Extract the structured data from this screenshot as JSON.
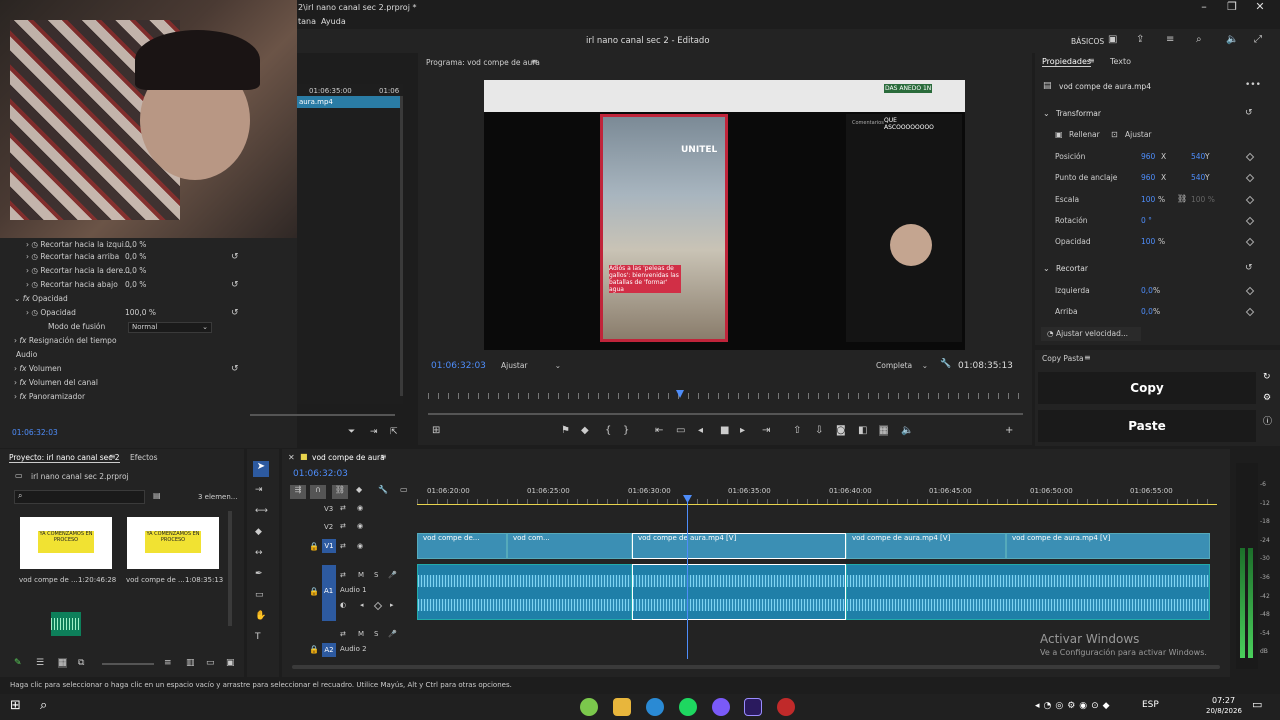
{
  "window": {
    "title": "2\\irl nano canal sec 2.prproj *",
    "menu": [
      "tana",
      "Ayuda"
    ],
    "project_title": "irl nano canal sec 2 - Editado",
    "workspace": "BÁSICOS"
  },
  "source": {
    "time_marker": "01:06:35:00",
    "time_marker2": "01:06",
    "clip_label": "aura.mp4",
    "timecode": "01:06:32:03"
  },
  "effects": {
    "rows": [
      {
        "label": "Recortar hacia la izqui...",
        "value": "0,0 %"
      },
      {
        "label": "Recortar hacia arriba",
        "value": "0,0 %"
      },
      {
        "label": "Recortar hacia la dere...",
        "value": "0,0 %"
      },
      {
        "label": "Recortar hacia abajo",
        "value": "0,0 %"
      }
    ],
    "opacity_group": "Opacidad",
    "opacity_label": "Opacidad",
    "opacity_value": "100,0 %",
    "blend_label": "Modo de fusión",
    "blend_value": "Normal",
    "time_remap": "Resignación del tiempo",
    "audio_section": "Audio",
    "audio_rows": [
      "Volumen",
      "Volumen del canal",
      "Panoramizador"
    ]
  },
  "program": {
    "title": "Programa: vod compe de aura",
    "timecode": "01:06:32:03",
    "fit": "Ajustar",
    "quality": "Completa",
    "duration": "01:08:35:13",
    "video_text": {
      "brand": "UNITEL",
      "caption": "Adiós a las 'peleas de gallos': bienvenidas las batallas de 'formar' agua",
      "chat_header": "Comentarios",
      "chat_top": "QUE ASCOOOOOOOO",
      "chat_overlay": "DAS ANEDO 1N"
    }
  },
  "properties": {
    "tab1": "Propiedades",
    "tab2": "Texto",
    "clip": "vod compe de aura.mp4",
    "transform": "Transformar",
    "fill": "Rellenar",
    "fit": "Ajustar",
    "position_label": "Posición",
    "position_x": "960",
    "position_y": "540",
    "anchor_label": "Punto de anclaje",
    "anchor_x": "960",
    "anchor_y": "540",
    "scale_label": "Escala",
    "scale_value": "100",
    "scale_unit": "%",
    "scale_lock": "100 %",
    "rotation_label": "Rotación",
    "rotation_value": "0 °",
    "opacity_label": "Opacidad",
    "opacity_value": "100",
    "opacity_unit": "%",
    "crop": "Recortar",
    "left_label": "Izquierda",
    "left_value": "0,0",
    "left_unit": "%",
    "top_label": "Arriba",
    "top_value": "0,0",
    "top_unit": "%",
    "speed": "Ajustar velocidad...",
    "x": "X",
    "y": "Y"
  },
  "copypaste": {
    "title": "Copy Pasta",
    "copy": "Copy",
    "paste": "Paste"
  },
  "project": {
    "tab": "Proyecto: irl nano canal sec 2",
    "tab2": "Efectos",
    "file": "irl nano canal sec 2.prproj",
    "count": "3 elemen...",
    "items": [
      {
        "name": "vod compe de ...",
        "dur": "1:20:46:28",
        "thumb": "YA COMENZAMOS EN PROCESO"
      },
      {
        "name": "vod compe de ...",
        "dur": "1:08:35:13",
        "thumb": "YA COMENZAMOS EN PROCESO"
      }
    ]
  },
  "timeline": {
    "tab": "vod compe de aura",
    "timecode": "01:06:32:03",
    "ruler": [
      "01:06:20:00",
      "01:06:25:00",
      "01:06:30:00",
      "01:06:35:00",
      "01:06:40:00",
      "01:06:45:00",
      "01:06:50:00",
      "01:06:55:00"
    ],
    "tracks": [
      "V3",
      "V2",
      "V1",
      "A1",
      "A2"
    ],
    "audio1": "Audio 1",
    "audio2": "Audio 2",
    "clips": [
      "vod compe de...",
      "vod com...",
      "vod compe de aura.mp4 [V]",
      "vod compe de aura.mp4 [V]",
      "vod compe de aura.mp4 [V]"
    ],
    "meter": [
      "-6",
      "-12",
      "-18",
      "-24",
      "-30",
      "-36",
      "-42",
      "-48",
      "-54",
      "dB"
    ]
  },
  "watermark": {
    "line1": "Activar Windows",
    "line2": "Ve a Configuración para activar Windows."
  },
  "status": "Haga clic para seleccionar o haga clic en un espacio vacío y arrastre para seleccionar el recuadro. Utilice Mayús, Alt y Ctrl para otras opciones.",
  "tray": {
    "lang": "ESP",
    "time": "07:27",
    "date": "20/8/2026"
  },
  "colors": {
    "accent": "#4e8dfa",
    "clip_video": "#3b8fb4",
    "clip_audio": "#1f7fa8",
    "playhead": "#4e8dfa"
  }
}
